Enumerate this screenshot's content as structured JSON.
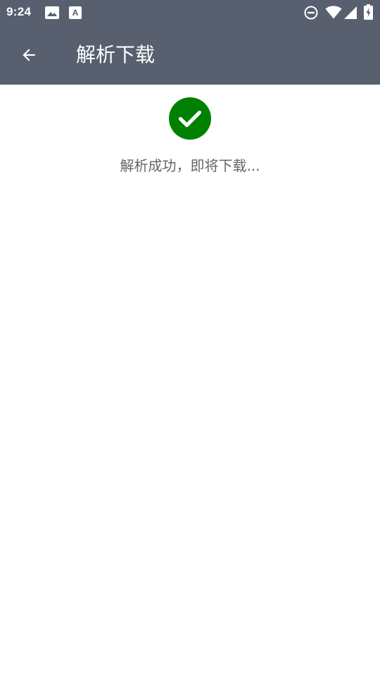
{
  "status_bar": {
    "time": "9:24",
    "left_icons": [
      "image-icon",
      "keyboard-a-icon"
    ],
    "right_icons": [
      "do-not-disturb-icon",
      "wifi-icon",
      "cellular-signal-icon",
      "battery-charging-icon"
    ]
  },
  "app_bar": {
    "back_icon": "arrow-back-icon",
    "title": "解析下载",
    "background": "#58606f"
  },
  "content": {
    "status_icon": "check-circle-icon",
    "status_color": "#008000",
    "message": "解析成功，即将下载..."
  }
}
